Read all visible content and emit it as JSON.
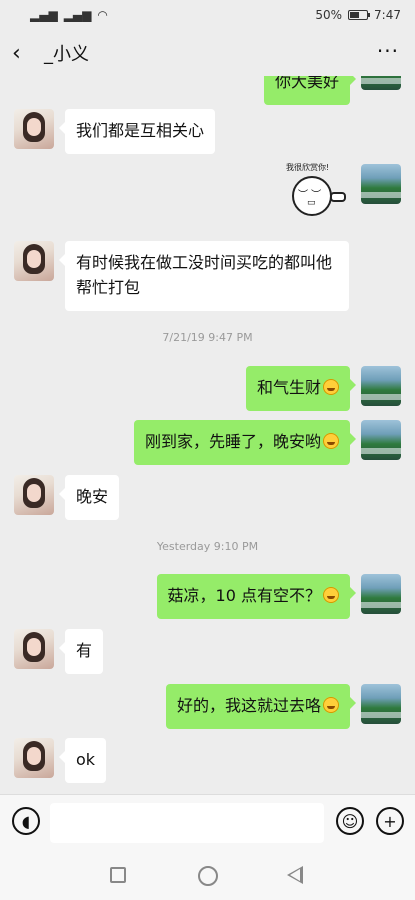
{
  "status": {
    "battery_pct": "50%",
    "time": "7:47",
    "battery_level": 0.5
  },
  "header": {
    "title": "_小义"
  },
  "messages": [
    {
      "side": "right",
      "type": "text",
      "text": "你大美好"
    },
    {
      "side": "left",
      "type": "text",
      "text": "我们都是互相关心"
    },
    {
      "side": "right",
      "type": "sticker",
      "caption": "我很欣赏你!"
    },
    {
      "side": "left",
      "type": "text",
      "text": "有时候我在做工没时间买吃的都叫他帮忙打包"
    },
    {
      "type": "time",
      "text": "7/21/19 9:47 PM"
    },
    {
      "side": "right",
      "type": "text",
      "text": "和气生财"
    },
    {
      "side": "right",
      "type": "text",
      "text": "刚到家，先睡了，晚安哟"
    },
    {
      "side": "left",
      "type": "text",
      "text": "晚安"
    },
    {
      "type": "time",
      "text": "Yesterday 9:10 PM"
    },
    {
      "side": "right",
      "type": "text",
      "text": "菇凉，10 点有空不？"
    },
    {
      "side": "left",
      "type": "text",
      "text": "有"
    },
    {
      "side": "right",
      "type": "text",
      "text": "好的，我这就过去咯"
    },
    {
      "side": "left",
      "type": "text",
      "text": "ok"
    }
  ],
  "input": {
    "value": ""
  }
}
